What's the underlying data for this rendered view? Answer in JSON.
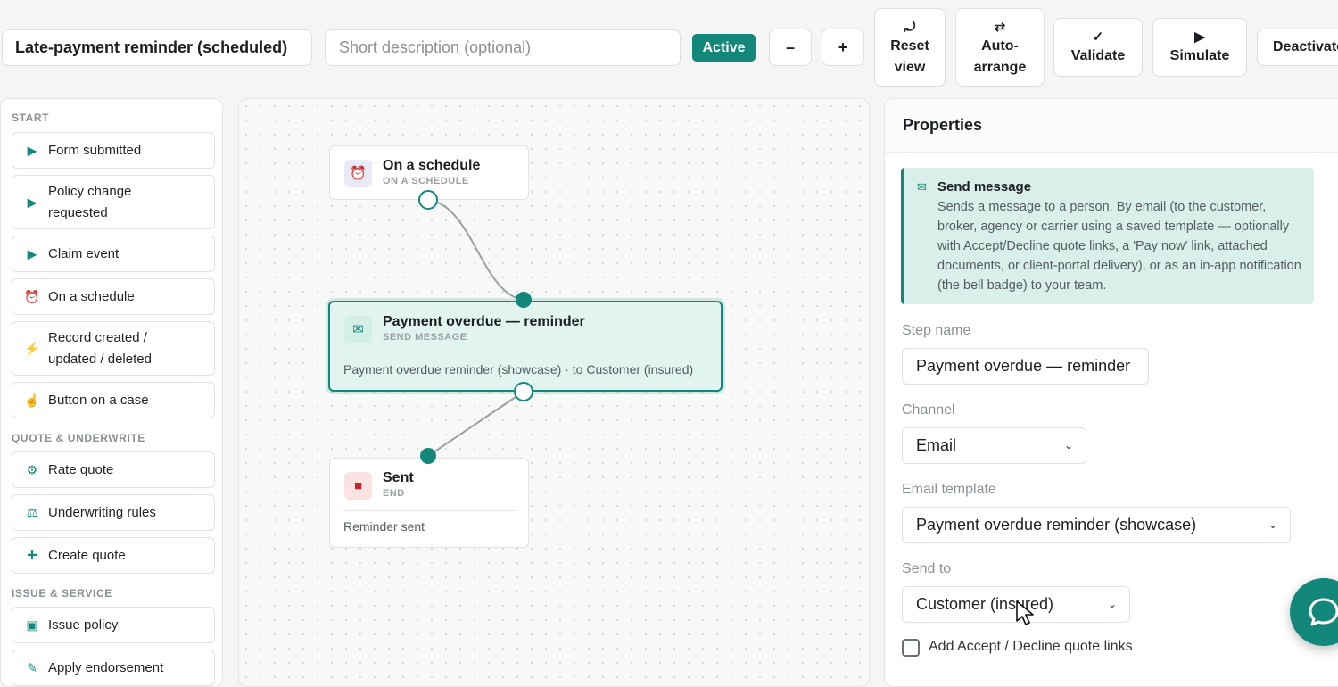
{
  "header": {
    "workflow_name": "Late-payment reminder (scheduled)",
    "description_placeholder": "Short description (optional)",
    "status_badge": "Active",
    "zoom_out_label": "–",
    "zoom_in_label": "+",
    "reset_view": {
      "glyph": "⤾",
      "line1": "Reset",
      "line2": "view"
    },
    "auto_arrange": {
      "glyph": "⇄",
      "line1": "Auto-",
      "line2": "arrange"
    },
    "validate": {
      "glyph": "✓",
      "label": "Validate"
    },
    "simulate": {
      "glyph": "▶",
      "label": "Simulate"
    },
    "deactivate": {
      "label": "Deactivate"
    }
  },
  "palette": {
    "sections": [
      {
        "title": "START",
        "items": [
          {
            "icon": "play-icon",
            "glyph": "▶",
            "label": "Form submitted"
          },
          {
            "icon": "play-icon",
            "glyph": "▶",
            "label": "Policy change requested"
          },
          {
            "icon": "play-icon",
            "glyph": "▶",
            "label": "Claim event"
          },
          {
            "icon": "alarm-clock-icon",
            "glyph": "⏰",
            "label": "On a schedule"
          },
          {
            "icon": "lightning-icon",
            "glyph": "⚡",
            "label": "Record created / updated / deleted"
          },
          {
            "icon": "pointing-hand-icon",
            "glyph": "☝",
            "label": "Button on a case"
          }
        ]
      },
      {
        "title": "QUOTE & UNDERWRITE",
        "items": [
          {
            "icon": "gear-icon",
            "glyph": "⚙",
            "label": "Rate quote"
          },
          {
            "icon": "scales-icon",
            "glyph": "⚖",
            "label": "Underwriting rules"
          },
          {
            "icon": "plus-icon",
            "glyph": "+",
            "label": "Create quote"
          }
        ]
      },
      {
        "title": "ISSUE & SERVICE",
        "items": [
          {
            "icon": "document-icon",
            "glyph": "▣",
            "label": "Issue policy"
          },
          {
            "icon": "pencil-icon",
            "glyph": "✎",
            "label": "Apply endorsement"
          }
        ]
      }
    ]
  },
  "canvas": {
    "nodes": [
      {
        "id": "trigger",
        "title": "On a schedule",
        "subtitle": "ON A SCHEDULE",
        "icon": "alarm-clock-icon",
        "glyph": "⏰"
      },
      {
        "id": "send",
        "title": "Payment overdue — reminder",
        "subtitle": "SEND MESSAGE",
        "icon": "envelope-icon",
        "glyph": "✉",
        "body": "Payment overdue reminder (showcase) · to Customer (insured)"
      },
      {
        "id": "end",
        "title": "Sent",
        "subtitle": "END",
        "icon": "stop-icon",
        "glyph": "■",
        "body": "Reminder sent"
      }
    ]
  },
  "properties": {
    "title": "Properties",
    "info": {
      "icon": "envelope-icon",
      "glyph": "✉",
      "title": "Send message",
      "body": "Sends a message to a person. By email (to the customer, broker, agency or carrier using a saved template — optionally with Accept/Decline quote links, a 'Pay now' link, attached documents, or client-portal delivery), or as an in-app notification (the bell badge) to your team."
    },
    "step_name_label": "Step name",
    "step_name_value": "Payment overdue — reminder",
    "channel_label": "Channel",
    "channel_value": "Email",
    "template_label": "Email template",
    "template_value": "Payment overdue reminder (showcase)",
    "send_to_label": "Send to",
    "send_to_value": "Customer (insured)",
    "quote_links_label": "Add Accept / Decline quote links"
  },
  "colors": {
    "accent": "#12877a",
    "selected_node_bg": "#e1f4ef",
    "info_bg": "#d9f0ea",
    "end_icon": "#c62828"
  }
}
